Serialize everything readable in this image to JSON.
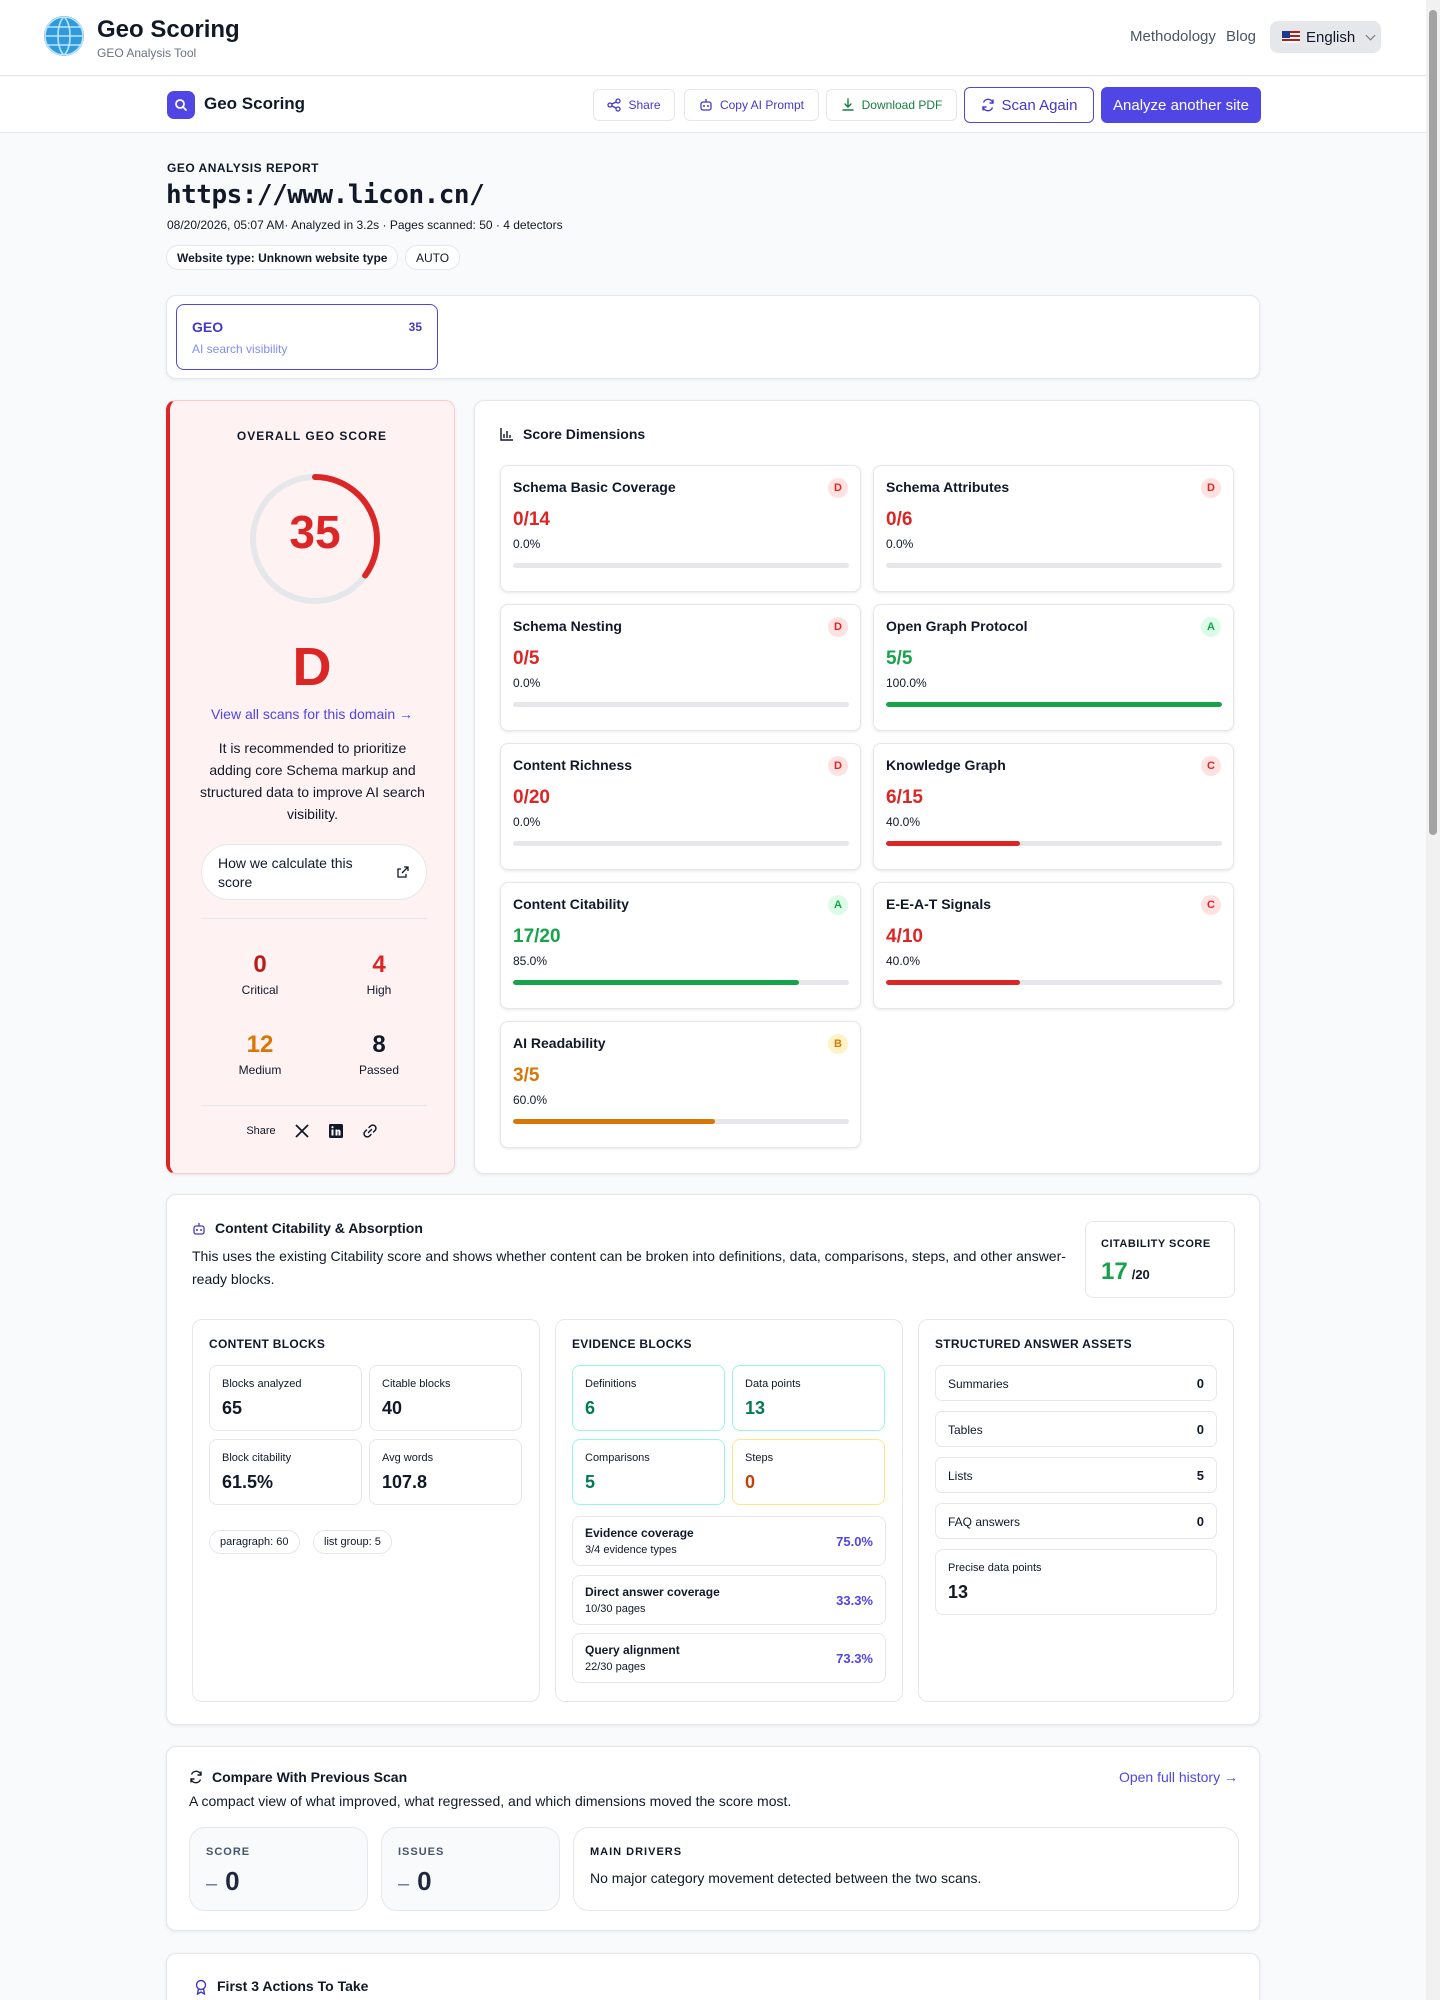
{
  "nav": {
    "brand_title": "Geo Scoring",
    "brand_subtitle": "GEO Analysis Tool",
    "links": [
      "Methodology",
      "Blog"
    ],
    "language": "English"
  },
  "toolbar": {
    "title": "Geo Scoring",
    "share": "Share",
    "copy_prompt": "Copy AI Prompt",
    "download_pdf": "Download PDF",
    "scan_again": "Scan Again",
    "analyze_another": "Analyze another site"
  },
  "report": {
    "label": "GEO ANALYSIS REPORT",
    "url": "https://www.licon.cn/",
    "meta": "08/20/2026, 05:07 AM· Analyzed in 3.2s · Pages scanned: 50 · 4 detectors",
    "website_type": "Website type: Unknown website type",
    "mode": "AUTO"
  },
  "geo_tab": {
    "name": "GEO",
    "score": "35",
    "desc": "AI search visibility"
  },
  "overall": {
    "label": "OVERALL GEO SCORE",
    "score": "35",
    "score_value": 35,
    "grade": "D",
    "view_scans": "View all scans for this domain →",
    "recommendation": "It is recommended to prioritize adding core Schema markup and structured data to improve AI search visibility.",
    "calc_link": "How we calculate this score",
    "stats": [
      {
        "value": "0",
        "label": "Critical",
        "color": "#b91c1c"
      },
      {
        "value": "4",
        "label": "High",
        "color": "#dc2626"
      },
      {
        "value": "12",
        "label": "Medium",
        "color": "#d97706"
      },
      {
        "value": "8",
        "label": "Passed",
        "color": "#111827"
      }
    ],
    "share_label": "Share"
  },
  "dimensions": {
    "title": "Score Dimensions",
    "items": [
      {
        "name": "Schema Basic Coverage",
        "grade": "D",
        "score": "0/14",
        "pct": "0.0%",
        "fraction": 0.0,
        "color": "#dc2626",
        "badge_bg": "#fee2e2",
        "badge_fg": "#dc2626"
      },
      {
        "name": "Schema Attributes",
        "grade": "D",
        "score": "0/6",
        "pct": "0.0%",
        "fraction": 0.0,
        "color": "#dc2626",
        "badge_bg": "#fee2e2",
        "badge_fg": "#dc2626"
      },
      {
        "name": "Schema Nesting",
        "grade": "D",
        "score": "0/5",
        "pct": "0.0%",
        "fraction": 0.0,
        "color": "#dc2626",
        "badge_bg": "#fee2e2",
        "badge_fg": "#dc2626"
      },
      {
        "name": "Open Graph Protocol",
        "grade": "A",
        "score": "5/5",
        "pct": "100.0%",
        "fraction": 1.0,
        "color": "#16a34a",
        "badge_bg": "#dcfce7",
        "badge_fg": "#16a34a"
      },
      {
        "name": "Content Richness",
        "grade": "D",
        "score": "0/20",
        "pct": "0.0%",
        "fraction": 0.0,
        "color": "#dc2626",
        "badge_bg": "#fee2e2",
        "badge_fg": "#dc2626"
      },
      {
        "name": "Knowledge Graph",
        "grade": "C",
        "score": "6/15",
        "pct": "40.0%",
        "fraction": 0.4,
        "color": "#dc2626",
        "badge_bg": "#fee2e2",
        "badge_fg": "#dc2626"
      },
      {
        "name": "Content Citability",
        "grade": "A",
        "score": "17/20",
        "pct": "85.0%",
        "fraction": 0.85,
        "color": "#16a34a",
        "badge_bg": "#dcfce7",
        "badge_fg": "#16a34a"
      },
      {
        "name": "E-E-A-T Signals",
        "grade": "C",
        "score": "4/10",
        "pct": "40.0%",
        "fraction": 0.4,
        "color": "#dc2626",
        "badge_bg": "#fee2e2",
        "badge_fg": "#dc2626"
      },
      {
        "name": "AI Readability",
        "grade": "B",
        "score": "3/5",
        "pct": "60.0%",
        "fraction": 0.6,
        "color": "#d97706",
        "badge_bg": "#fef3c7",
        "badge_fg": "#d97706"
      }
    ]
  },
  "citability": {
    "title": "Content Citability & Absorption",
    "description": "This uses the existing Citability score and shows whether content can be broken into definitions, data, comparisons, steps, and other answer-ready blocks.",
    "score_label": "CITABILITY SCORE",
    "score": "17",
    "score_den": "/20",
    "content_blocks": {
      "title": "CONTENT BLOCKS",
      "cells": [
        {
          "label": "Blocks analyzed",
          "value": "65"
        },
        {
          "label": "Citable blocks",
          "value": "40"
        },
        {
          "label": "Block citability",
          "value": "61.5%"
        },
        {
          "label": "Avg words",
          "value": "107.8"
        }
      ],
      "chips": [
        "paragraph: 60",
        "list group: 5"
      ]
    },
    "evidence_blocks": {
      "title": "EVIDENCE BLOCKS",
      "cells": [
        {
          "label": "Definitions",
          "value": "6",
          "color": "#047857",
          "border": "#99f6e4"
        },
        {
          "label": "Data points",
          "value": "13",
          "color": "#047857",
          "border": "#99f6e4"
        },
        {
          "label": "Comparisons",
          "value": "5",
          "color": "#047857",
          "border": "#99f6e4"
        },
        {
          "label": "Steps",
          "value": "0",
          "color": "#c2410c",
          "border": "#fde68a"
        }
      ],
      "coverage": [
        {
          "label": "Evidence coverage",
          "sub": "3/4 evidence types",
          "value": "75.0%"
        },
        {
          "label": "Direct answer coverage",
          "sub": "10/30 pages",
          "value": "33.3%"
        },
        {
          "label": "Query alignment",
          "sub": "22/30 pages",
          "value": "73.3%"
        }
      ]
    },
    "structured": {
      "title": "STRUCTURED ANSWER ASSETS",
      "rows": [
        {
          "label": "Summaries",
          "value": "0"
        },
        {
          "label": "Tables",
          "value": "0"
        },
        {
          "label": "Lists",
          "value": "5"
        },
        {
          "label": "FAQ answers",
          "value": "0"
        }
      ],
      "precise_label": "Precise data points",
      "precise_value": "13"
    }
  },
  "compare": {
    "title": "Compare With Previous Scan",
    "link": "Open full history →",
    "description": "A compact view of what improved, what regressed, and which dimensions moved the score most.",
    "score_label": "SCORE",
    "score_value": "0",
    "issues_label": "ISSUES",
    "issues_value": "0",
    "drivers_label": "MAIN DRIVERS",
    "drivers_text": "No major category movement detected between the two scans."
  },
  "actions": {
    "title": "First 3 Actions To Take"
  }
}
